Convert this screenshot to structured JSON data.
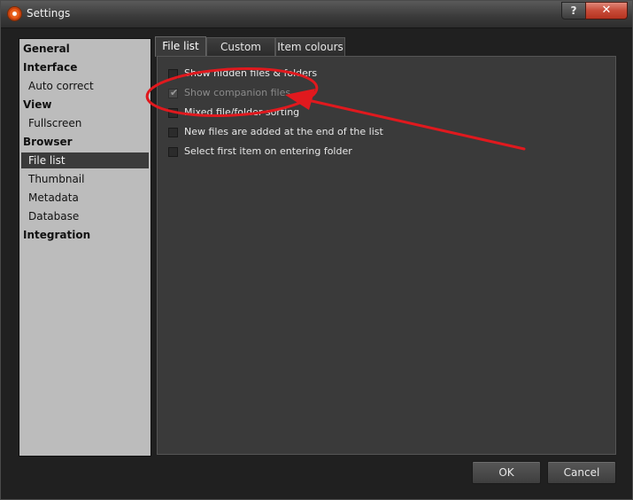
{
  "window": {
    "title": "Settings",
    "help_glyph": "?",
    "close_glyph": "✕"
  },
  "sidebar": {
    "items": [
      {
        "label": "General",
        "level": "head"
      },
      {
        "label": "Interface",
        "level": "head"
      },
      {
        "label": "Auto correct",
        "level": "sub"
      },
      {
        "label": "View",
        "level": "head"
      },
      {
        "label": "Fullscreen",
        "level": "sub"
      },
      {
        "label": "Browser",
        "level": "head"
      },
      {
        "label": "File list",
        "level": "sub",
        "selected": true
      },
      {
        "label": "Thumbnail",
        "level": "sub"
      },
      {
        "label": "Metadata",
        "level": "sub"
      },
      {
        "label": "Database",
        "level": "sub"
      },
      {
        "label": "Integration",
        "level": "head"
      }
    ]
  },
  "tabs": [
    {
      "label": "File list",
      "active": true
    },
    {
      "label": "Custom filter"
    },
    {
      "label": "Item colours"
    }
  ],
  "options": [
    {
      "label": "Show hidden files & folders",
      "checked": false
    },
    {
      "label": "Show companion files",
      "checked": true,
      "disabled": true
    },
    {
      "label": "Mixed file/folder sorting",
      "checked": false
    },
    {
      "label": "New files are added at the end of the list",
      "checked": false
    },
    {
      "label": "Select first item on entering folder",
      "checked": false
    }
  ],
  "buttons": {
    "ok": "OK",
    "cancel": "Cancel"
  },
  "colors": {
    "annotation": "#e0191e",
    "app_icon": "#e85d1a"
  }
}
